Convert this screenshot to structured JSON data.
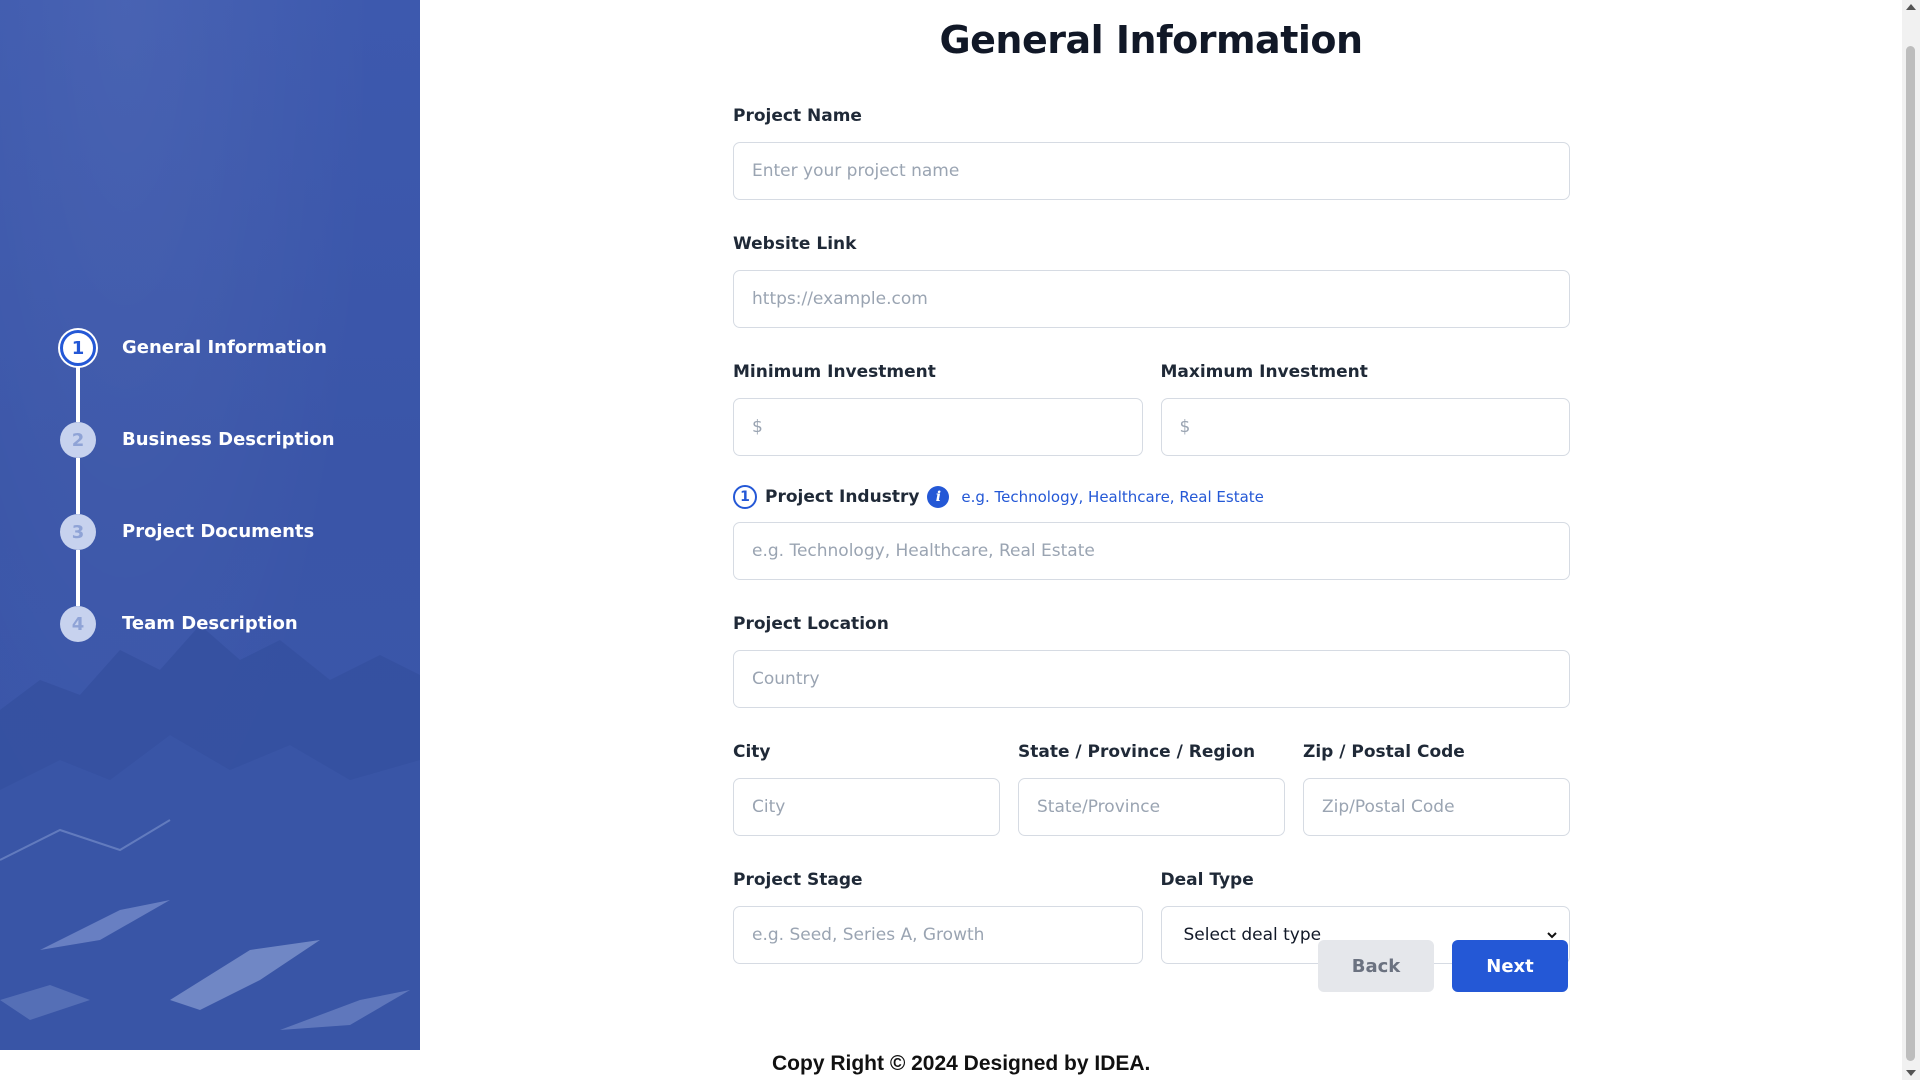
{
  "sidebar": {
    "steps": [
      {
        "number": "1",
        "label": "General Information",
        "active": true
      },
      {
        "number": "2",
        "label": "Business Description",
        "active": false
      },
      {
        "number": "3",
        "label": "Project Documents",
        "active": false
      },
      {
        "number": "4",
        "label": "Team Description",
        "active": false
      }
    ]
  },
  "main": {
    "title": "General Information",
    "fields": {
      "project_name": {
        "label": "Project Name",
        "placeholder": "Enter your project name"
      },
      "website_link": {
        "label": "Website Link",
        "placeholder": "https://example.com"
      },
      "min_investment": {
        "label": "Minimum Investment",
        "placeholder": "$"
      },
      "max_investment": {
        "label": "Maximum Investment",
        "placeholder": "$"
      },
      "project_industry": {
        "badge": "1",
        "label": "Project Industry",
        "hint": "e.g. Technology, Healthcare, Real Estate",
        "placeholder": "e.g. Technology, Healthcare, Real Estate"
      },
      "project_location": {
        "label": "Project Location",
        "placeholder": "Country"
      },
      "city": {
        "label": "City",
        "placeholder": "City"
      },
      "state": {
        "label": "State / Province / Region",
        "placeholder": "State/Province"
      },
      "zip": {
        "label": "Zip / Postal Code",
        "placeholder": "Zip/Postal Code"
      },
      "project_stage": {
        "label": "Project Stage",
        "placeholder": "e.g. Seed, Series A, Growth"
      },
      "deal_type": {
        "label": "Deal Type",
        "selected": "Select deal type"
      }
    },
    "buttons": {
      "back": "Back",
      "next": "Next"
    }
  },
  "footer": {
    "text": "Copy Right © 2024 Designed by IDEA."
  },
  "colors": {
    "accent": "#2458d6",
    "sidebar": "#3a56aa"
  },
  "icons": {
    "info": "info-icon",
    "select_arrow": "chevron-down-icon"
  }
}
